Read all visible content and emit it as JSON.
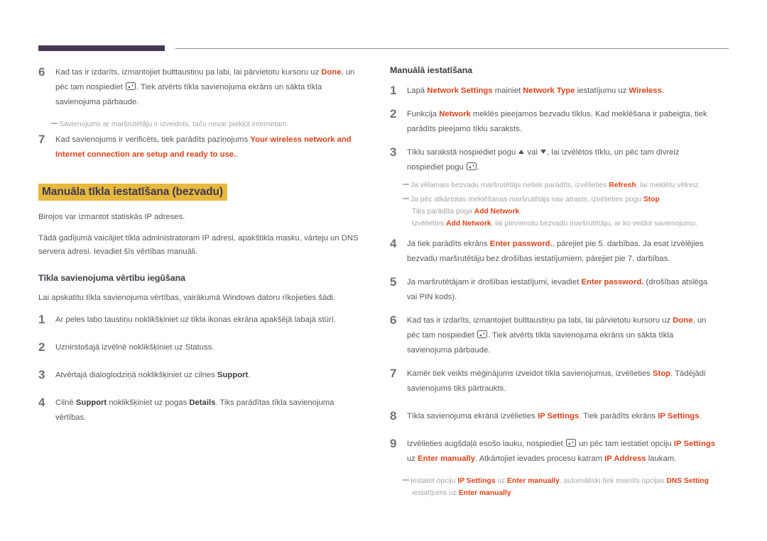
{
  "document": {
    "accent_color": "#df4318",
    "highlight_bg": "#e6b93f",
    "header_bar_color": "#463a52"
  },
  "left_column": {
    "step6": {
      "num": "6",
      "t1": "Kad tas ir izdarīts, izmantojiet bulttaustiņu pa labi, lai pārvietotu kursoru uz ",
      "a1": "Done",
      "t2": ", un pēc tam nospiediet ",
      "t3": ". Tiek atvērts tīkla savienojuma ekrāns un sākta tīkla savienojuma pārbaude."
    },
    "note1": "Savienojums ar maršrutētāju ir izveidots, taču nevar piekļūt internetam.",
    "step7": {
      "num": "7",
      "t1": "Kad savienojums ir verificēts, tiek parādīts paziņojums ",
      "a1": "Your wireless network and Internet connection are setup and ready to use.",
      "t2": "."
    },
    "heading_manual_wireless": "Manuāla tīkla iestatīšana (bezvadu)",
    "para1": "Birojos var izmantot statiskās IP adreses.",
    "para2": "Tādā gadījumā vaicājiet tīkla administratoram IP adresi, apakštikla masku, vārteju un DNS servera adresi. Ievadiet šīs vērtības manuāli.",
    "heading_get_values": "Tīkla savienojuma vērtību iegūšana",
    "para3": "Lai apskatītu tīkla savienojuma vērtības, vairākumā Windows datoru rīkojieties šādi.",
    "step1": {
      "num": "1",
      "t1": "Ar peles labo taustiņu noklikšķiniet uz tīkla ikonas ekrāna apakšējā labajā stūrī."
    },
    "step2": {
      "num": "2",
      "t1": "Uznirstošajā izvēlnē noklikšķiniet uz Statuss."
    },
    "step3": {
      "num": "3",
      "t1": "Atvērtajā dialoglodziņā noklikšķiniet uz cilnes ",
      "b1": "Support",
      "t2": "."
    },
    "step4": {
      "num": "4",
      "t1": "Cilnē ",
      "b1": "Support",
      "t2": " noklikšķiniet uz pogas ",
      "b2": "Details",
      "t3": ". Tiks parādītas tīkla savienojuma vērtības."
    }
  },
  "right_column": {
    "heading_manual_setup": "Manuālā iestatīšana",
    "step1": {
      "num": "1",
      "t1": "Lapā ",
      "a1": "Network Settings",
      "t2": " mainiet ",
      "a2": "Network Type",
      "t3": " iestatījumu uz ",
      "a3": "Wireless",
      "t4": "."
    },
    "step2": {
      "num": "2",
      "t1": "Funkcija ",
      "a1": "Network",
      "t2": " meklēs pieejamos bezvadu tīklus. Kad meklēšana ir pabeigta, tiek parādīts pieejamo tīklu saraksts."
    },
    "step3": {
      "num": "3",
      "t1": "Tīklu sarakstā nospiediet pogu ",
      "t2": " vai ",
      "t3": ", lai izvēlētos tīklu, un pēc tam divreiz nospiediet pogu ",
      "t4": "."
    },
    "note1": {
      "t1": "Ja vēlamais bezvadu maršrutētājs netiek parādīts, izvēlieties ",
      "a1": "Refresh",
      "t2": ", lai meklētu vēlreiz."
    },
    "note2": {
      "t1": "Ja pēc atkārtotas meklēšanas maršrutētājs nav atrasts, izvēlieties pogu ",
      "a1": "Stop",
      "t2": ".",
      "l2a": "Tiks parādīta poga ",
      "l2b": "Add Network",
      "l2c": ".",
      "l3a": "Izvēlieties ",
      "l3b": "Add Network",
      "l3c": ", lai pievienotu bezvadu maršrutētāju, ar ko veidot savienojumu."
    },
    "step4": {
      "num": "4",
      "t1": "Ja tiek parādīts ekrāns ",
      "a1": "Enter password.",
      "t2": ", pārejiet pie 5. darbības. Ja esat izvēlējies bezvadu maršrutētāju bez drošības iestatījumiem, pārejiet pie 7. darbības."
    },
    "step5": {
      "num": "5",
      "t1": "Ja maršrutētājam ir drošības iestatījumi, ievadiet ",
      "a1": "Enter password.",
      "t2": " (drošības atslēga vai PIN kods)."
    },
    "step6": {
      "num": "6",
      "t1": "Kad tas ir izdarīts, izmantojiet bulttaustiņu pa labi, lai pārvietotu kursoru uz ",
      "a1": "Done",
      "t2": ", un pēc tam nospiediet ",
      "t3": ". Tiek atvērts tīkla savienojuma ekrāns un sākta tīkla savienojuma pārbaude."
    },
    "step7": {
      "num": "7",
      "t1": "Kamēr tiek veikts mēģinājums izveidot tīkla savienojumus, izvēlieties ",
      "a1": "Stop",
      "t2": ". Tādējādi savienojums tiks pārtraukts."
    },
    "step8": {
      "num": "8",
      "t1": "Tīkla savienojuma ekrānā izvēlieties ",
      "a1": "IP Settings",
      "t2": ". Tiek parādīts ekrāns ",
      "a2": "IP Settings",
      "t3": "."
    },
    "step9": {
      "num": "9",
      "t1": "Izvēlieties augšdaļā esošo lauku, nospiediet ",
      "t2": " un pēc tam iestatiet opciju ",
      "a1": "IP Settings",
      "t3": " uz ",
      "a2": "Enter manually",
      "t4": ". Atkārtojiet ievades procesu katram ",
      "a3": "IP Address",
      "t5": " laukam."
    },
    "note3": {
      "t1": "Iestatot opciju ",
      "a1": "IP Settings",
      "t2": " uz ",
      "a2": "Enter manually",
      "t3": ", automātiski tiek mainīts opcijas ",
      "a3": "DNS Setting",
      "l2a": "iestatījums uz ",
      "l2b": "Enter manually",
      "l2c": "."
    }
  }
}
